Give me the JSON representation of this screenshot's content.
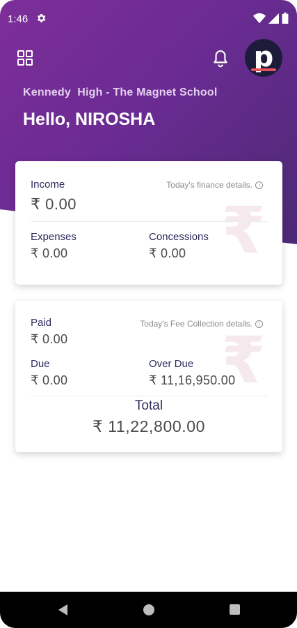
{
  "status_bar": {
    "time": "1:46"
  },
  "header": {
    "school_name": "Kennedy  High - The Magnet School",
    "greeting": "Hello, NIROSHA",
    "avatar_letter": "p"
  },
  "finance_card": {
    "income_label": "Income",
    "income_value": "₹ 0.00",
    "hint": "Today's finance details.",
    "expenses_label": "Expenses",
    "expenses_value": "₹ 0.00",
    "concessions_label": "Concessions",
    "concessions_value": "₹ 0.00"
  },
  "fee_card": {
    "paid_label": "Paid",
    "paid_value": "₹ 0.00",
    "hint": "Today's Fee Collection details.",
    "due_label": "Due",
    "due_value": "₹ 0.00",
    "over_due_label": "Over Due",
    "over_due_value": "₹ 11,16,950.00",
    "total_label": "Total",
    "total_value": "₹ 11,22,800.00"
  },
  "watermark_glyph": "₹",
  "info_glyph": "i",
  "colors": {
    "header_gradient_start": "#7e2e99",
    "header_gradient_end": "#4a2a72",
    "label_text": "#2b2d5c",
    "avatar_accent": "#e5515d"
  }
}
